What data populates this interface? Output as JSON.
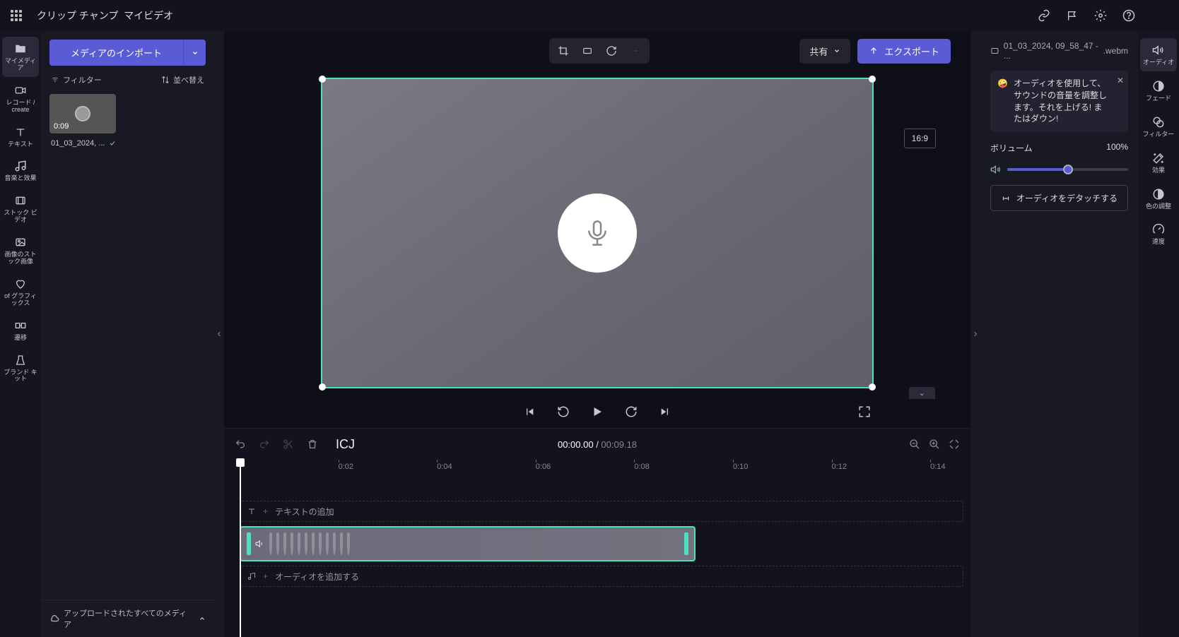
{
  "header": {
    "app": "クリップ チャンプ",
    "project": "マイビデオ"
  },
  "leftNav": {
    "myMedia": "マイメディア",
    "record": "レコード / create",
    "text": "テキスト",
    "music": "音楽と效果",
    "stockVideo": "ストック ビデオ",
    "stockImage": "画像のストック画像",
    "graphics": "of グラフィックス",
    "transitions": "遷移",
    "brandKit": "ブランド キット"
  },
  "mediaPanel": {
    "import": "メディアのインポート",
    "filter": "フィルター",
    "sort": "並べ替え",
    "clipDur": "0:09",
    "clipName": "01_03_2024, ...",
    "uploadAll": "アップロードされたすべてのメディア"
  },
  "toolbar": {
    "share": "共有",
    "export": "エクスポート",
    "aspect": "16:9"
  },
  "playback": {
    "current": "00:00.00",
    "total": "00:09.18"
  },
  "timeline": {
    "title": "ICJ",
    "ticks": [
      "0:02",
      "0:04",
      "0:06",
      "0:08",
      "0:10",
      "0:12",
      "0:14"
    ],
    "addText": "テキストの追加",
    "addAudio": "オーディオを追加する"
  },
  "rightPanel": {
    "fileName": "01_03_2024, 09_58_47 - ...",
    "fileExt": ".webm",
    "tip": "オーディオを使用して、サウンドの音量を調整します。それを上げる! またはダウン!",
    "volumeLabel": "ボリューム",
    "volumeValue": "100%",
    "detach": "オーディオをデタッチする"
  },
  "rightNav": {
    "audio": "オーディオ",
    "fade": "フェード",
    "filter": "フィルター",
    "effects": "効果",
    "color": "色の調整",
    "speed": "速度"
  }
}
